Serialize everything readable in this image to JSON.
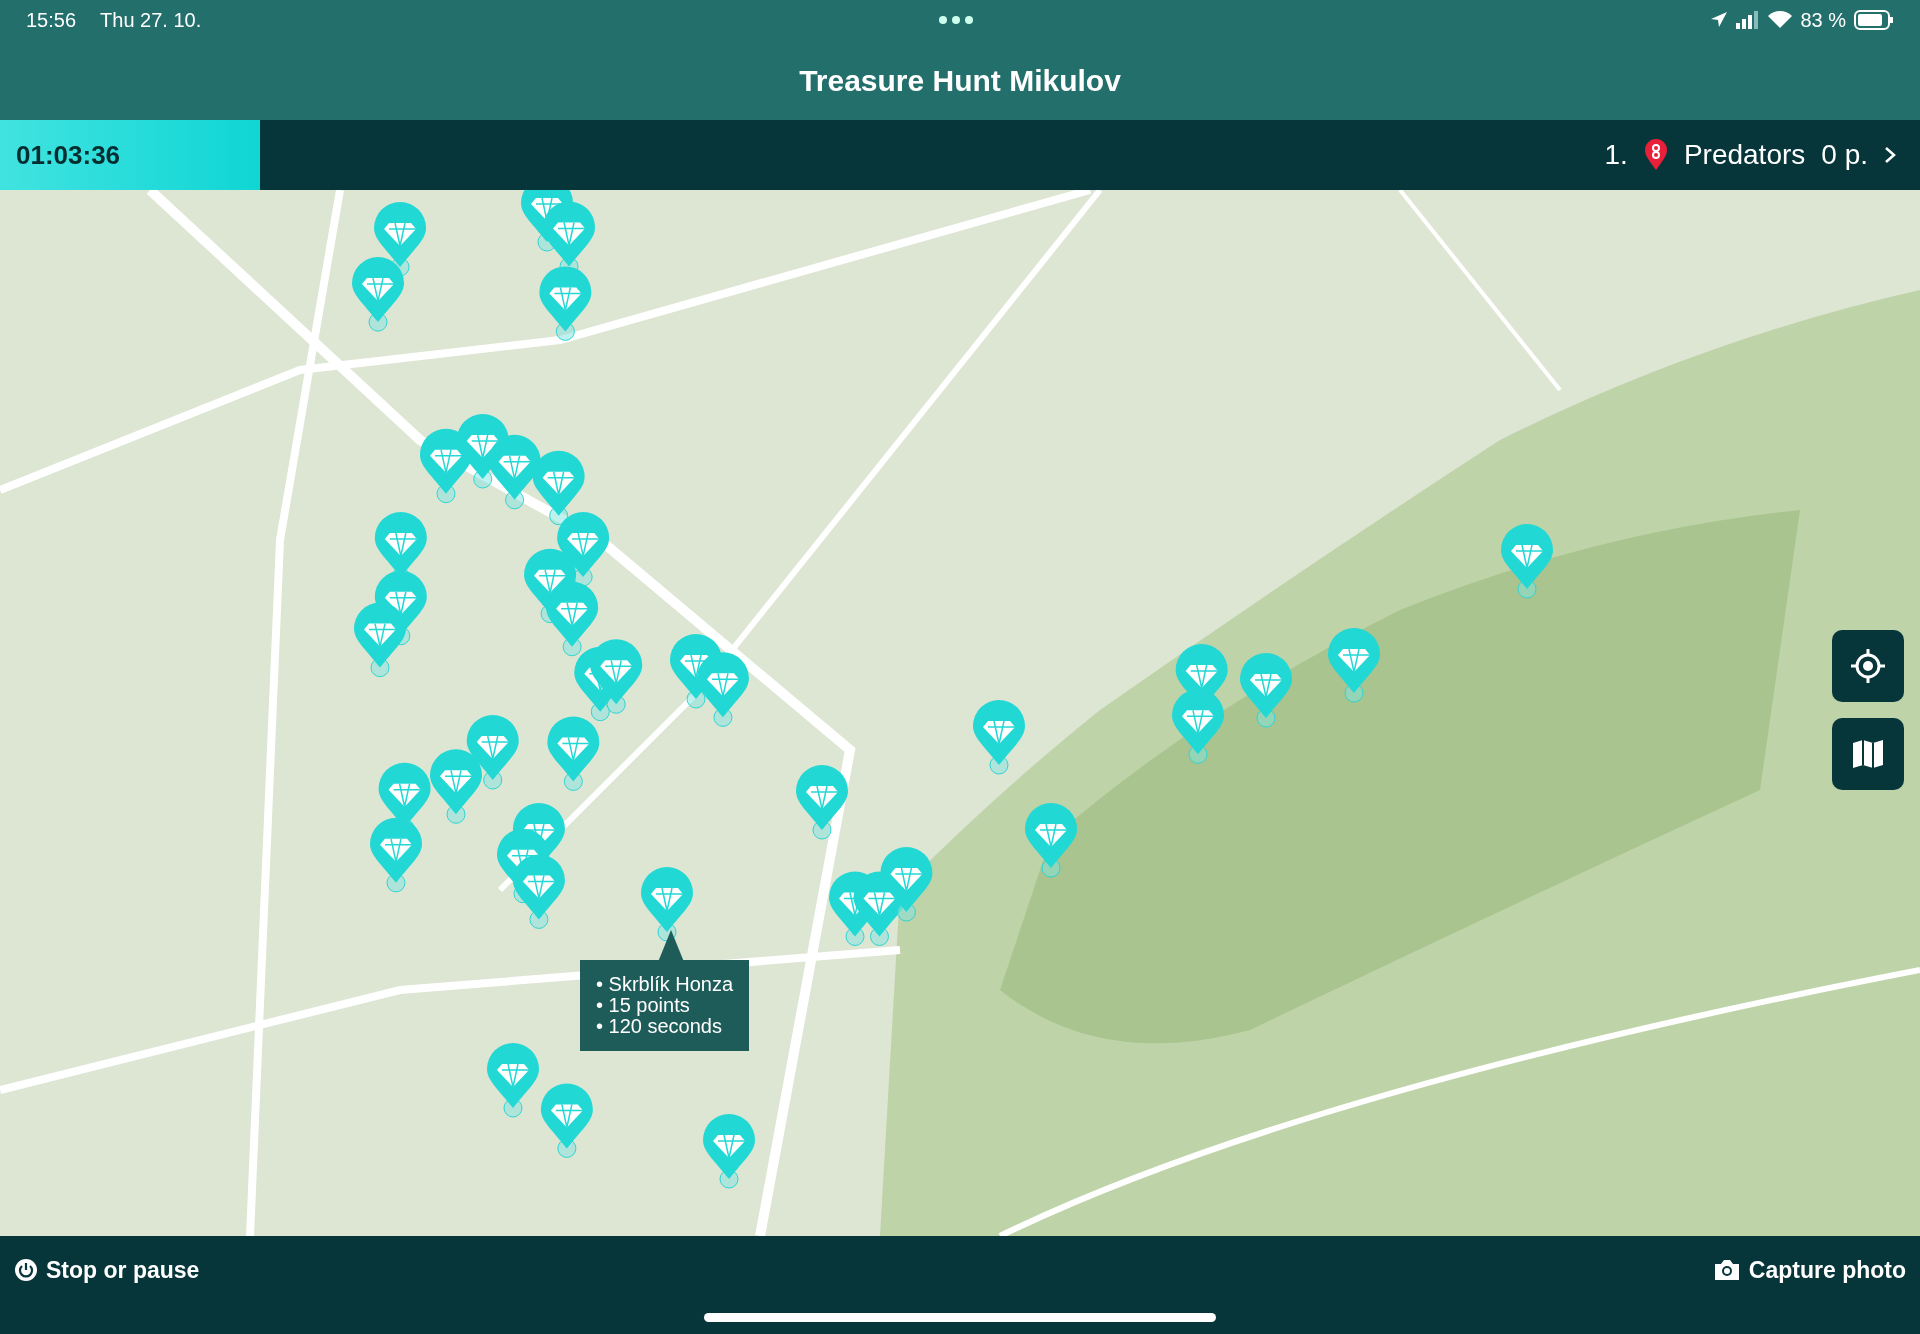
{
  "status_bar": {
    "time": "15:56",
    "date": "Thu 27. 10.",
    "battery": "83 %"
  },
  "header": {
    "title": "Treasure Hunt Mikulov"
  },
  "timer_bar": {
    "timer": "01:03:36",
    "rank": "1.",
    "team": "Predators",
    "score": "0 p."
  },
  "map": {
    "tooltip": [
      "• Skrblík Honza",
      "• 15 points",
      "• 120 seconds"
    ]
  },
  "bottom_bar": {
    "left_button": "Stop or pause",
    "right_button": "Capture photo"
  }
}
